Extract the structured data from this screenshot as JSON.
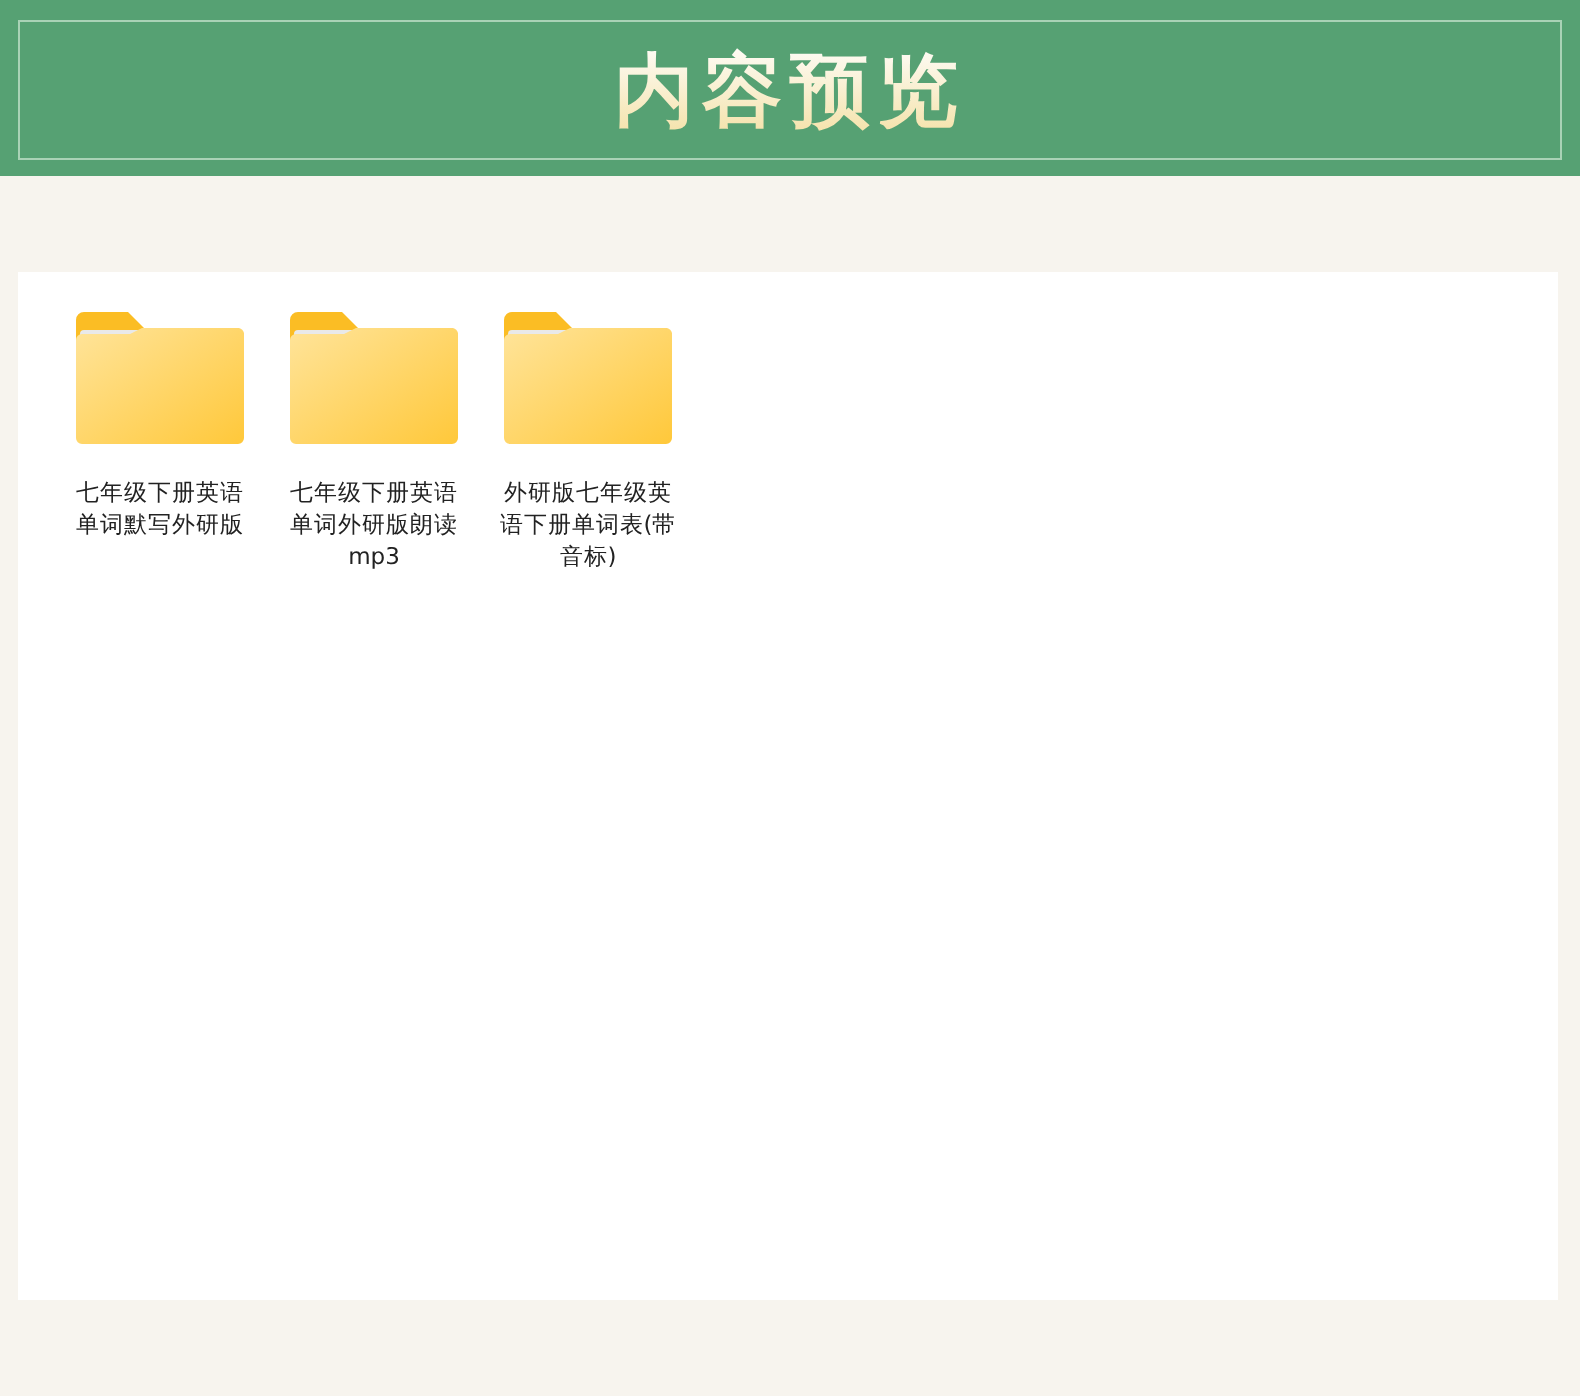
{
  "header": {
    "title": "内容预览"
  },
  "files": [
    {
      "kind": "folder",
      "name": "七年级下册英语单词默写外研版"
    },
    {
      "kind": "folder",
      "name": "七年级下册英语单词外研版朗读mp3"
    },
    {
      "kind": "folder",
      "name": "外研版七年级英语下册单词表(带音标)"
    }
  ]
}
